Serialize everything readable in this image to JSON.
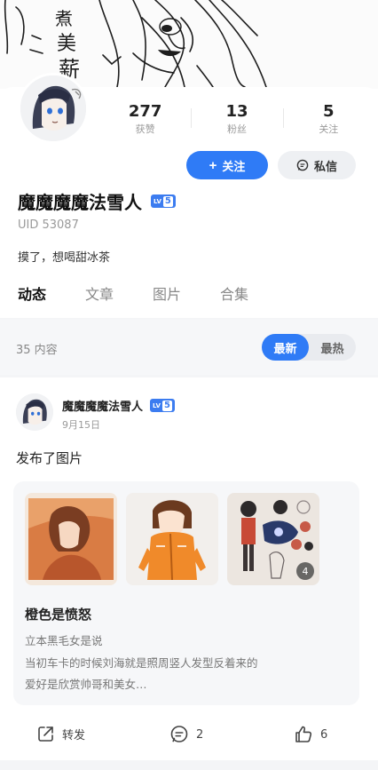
{
  "profile": {
    "name": "魔魔魔魔法雪人",
    "level_prefix": "LV",
    "level": "5",
    "uid": "UID 53087",
    "bio": "摸了，想喝甜冰茶",
    "banner_text": "煮美薪"
  },
  "stats": [
    {
      "value": "277",
      "label": "获赞"
    },
    {
      "value": "13",
      "label": "粉丝"
    },
    {
      "value": "5",
      "label": "关注"
    }
  ],
  "buttons": {
    "follow": "关注",
    "follow_icon": "+",
    "message": "私信"
  },
  "tabs": [
    {
      "label": "动态",
      "active": true
    },
    {
      "label": "文章",
      "active": false
    },
    {
      "label": "图片",
      "active": false
    },
    {
      "label": "合集",
      "active": false
    }
  ],
  "feed": {
    "count": "35 内容",
    "sort": [
      {
        "label": "最新",
        "active": true
      },
      {
        "label": "最热",
        "active": false
      }
    ]
  },
  "post": {
    "author": "魔魔魔魔法雪人",
    "date": "9月15日",
    "text": "发布了图片",
    "extra_images": "4",
    "card": {
      "title": "橙色是愤怒",
      "lines": [
        "立本黑毛女是说",
        "当初车卡的时候刘海就是照周竖人发型反着来的",
        "爱好是欣赏帅哥和美女…"
      ]
    },
    "actions": {
      "share": "转发",
      "comments": "2",
      "likes": "6"
    }
  },
  "colors": {
    "accent": "#2f7bf6",
    "level_badge": "#3c7cf0"
  }
}
